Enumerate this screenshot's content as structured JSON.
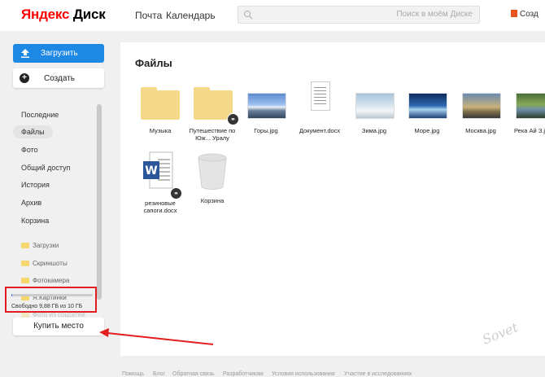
{
  "header": {
    "logo_brand": "Яндекс",
    "logo_product": "Диск",
    "nav_mail": "Почта",
    "nav_calendar": "Календарь",
    "search_placeholder": "Поиск в моём Диске",
    "office_label": "Созд"
  },
  "sidebar": {
    "upload_label": "Загрузить",
    "create_label": "Создать",
    "nav": [
      "Последние",
      "Файлы",
      "Фото",
      "Общий доступ",
      "История",
      "Архив",
      "Корзина"
    ],
    "active_index": 1,
    "folders": [
      "Загрузки",
      "Скриншоты",
      "Фотокамера",
      "Я.Картинки",
      "Фото из соцсетей"
    ],
    "quota_text": "Свободно 9,88 ГБ из 10 ГБ",
    "quota_used_fraction": 0.012,
    "buy_label": "Купить место"
  },
  "main": {
    "title": "Файлы",
    "items": [
      {
        "name": "Музыка",
        "type": "folder"
      },
      {
        "name": "Путешествие по Юж... Уралу",
        "type": "folder",
        "shared": true
      },
      {
        "name": "Горы.jpg",
        "type": "image"
      },
      {
        "name": "Документ.docx",
        "type": "doc"
      },
      {
        "name": "Зима.jpg",
        "type": "image"
      },
      {
        "name": "Море.jpg",
        "type": "image"
      },
      {
        "name": "Москва.jpg",
        "type": "image"
      },
      {
        "name": "Река Ай З.jpg",
        "type": "image"
      },
      {
        "name": "резиновые сапоги.docx",
        "type": "word",
        "shared": true
      },
      {
        "name": "Корзина",
        "type": "trash"
      }
    ]
  },
  "footer": {
    "links": [
      "Помощь",
      "Блог",
      "Обратная связь",
      "Разработчикам",
      "Условия использования",
      "Участие в исследованиях"
    ]
  },
  "watermark": "Sovet"
}
